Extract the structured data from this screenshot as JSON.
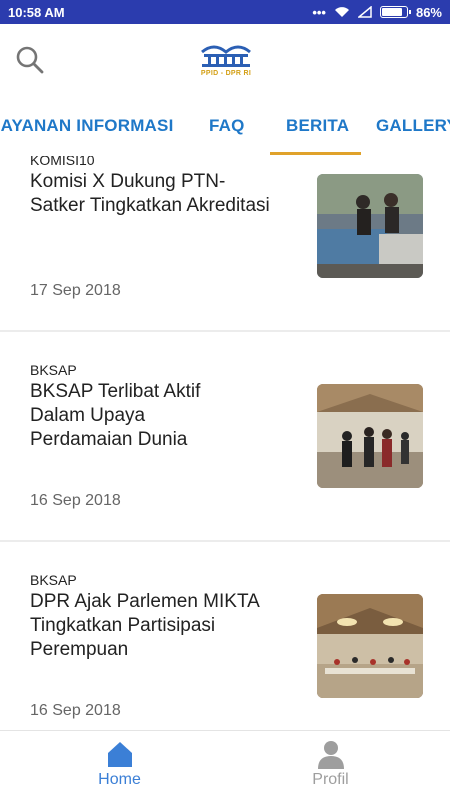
{
  "status_bar": {
    "time": "10:58 AM",
    "battery": "86%",
    "battery_level": 0.86
  },
  "app_bar": {
    "logo_text": "PPID - DPR RI",
    "search_icon": "search-icon"
  },
  "tabs": [
    {
      "label": "LAYANAN INFORMASI",
      "selected": false
    },
    {
      "label": "FAQ",
      "selected": false
    },
    {
      "label": "BERITA",
      "selected": true
    },
    {
      "label": "GALLERY",
      "selected": false
    }
  ],
  "colors": {
    "status_bar": "#2b3cae",
    "tab_text": "#1f78c8",
    "tab_indicator": "#e0a22a",
    "nav_active": "#3b7fd6",
    "nav_inactive": "#9e9e9e"
  },
  "news": [
    {
      "category": "KOMISI10",
      "title": "Komisi X Dukung PTN-Satker Tingkatkan Akreditasi",
      "date": "17 Sep 2018"
    },
    {
      "category": "BKSAP",
      "title": "BKSAP Terlibat Aktif Dalam Upaya Perdamaian Dunia",
      "date": "16 Sep 2018"
    },
    {
      "category": "BKSAP",
      "title": "DPR Ajak Parlemen MIKTA Tingkatkan Partisipasi Perempuan",
      "date": "16 Sep 2018"
    }
  ],
  "bottom_nav": [
    {
      "label": "Home",
      "icon": "home-icon",
      "active": true
    },
    {
      "label": "Profil",
      "icon": "person-icon",
      "active": false
    }
  ]
}
